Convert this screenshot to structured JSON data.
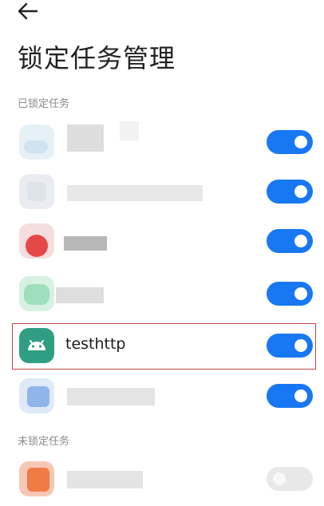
{
  "header": {
    "back_icon": "arrow-left-icon",
    "title": "锁定任务管理"
  },
  "sections": {
    "locked_label": "已锁定任务",
    "unlocked_label": "未锁定任务"
  },
  "locked_tasks": [
    {
      "label": "",
      "enabled": true
    },
    {
      "label": "",
      "enabled": true
    },
    {
      "label": "",
      "enabled": true
    },
    {
      "label": "",
      "enabled": true
    },
    {
      "label": "testhttp",
      "enabled": true
    },
    {
      "label": "",
      "enabled": true
    }
  ],
  "unlocked_tasks": [
    {
      "label": "",
      "enabled": false
    }
  ],
  "colors": {
    "toggle_on": "#1877f2",
    "toggle_off": "#e8e8e8",
    "android_icon_bg": "#2f9e83",
    "highlight_border": "#c2454b"
  }
}
